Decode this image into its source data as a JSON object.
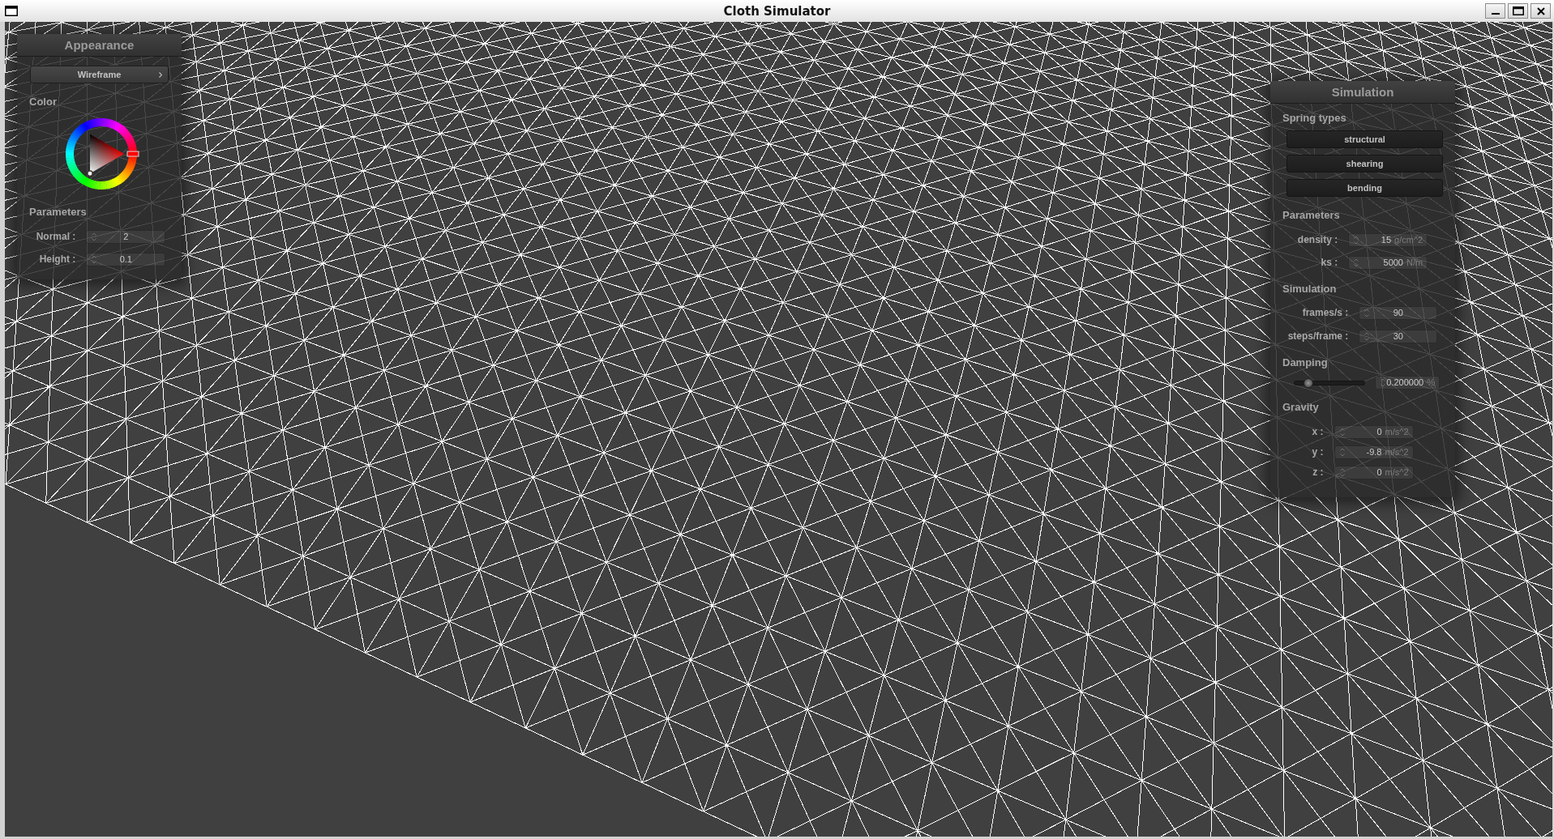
{
  "window": {
    "title": "Cloth Simulator"
  },
  "appearance_panel": {
    "title": "Appearance",
    "mode_button": {
      "label": "Wireframe"
    },
    "color_label": "Color",
    "color_picker": {
      "color": "#ffffff"
    },
    "parameters_label": "Parameters",
    "fields": [
      {
        "label": "Normal :",
        "value": "2"
      },
      {
        "label": "Height :",
        "value": "0.1"
      }
    ]
  },
  "simulation_panel": {
    "title": "Simulation",
    "spring_types": {
      "label": "Spring types",
      "buttons": [
        {
          "label": "structural",
          "on": true
        },
        {
          "label": "shearing",
          "on": true
        },
        {
          "label": "bending",
          "on": true
        }
      ]
    },
    "parameters": {
      "label": "Parameters",
      "fields": [
        {
          "label": "density :",
          "value": "15",
          "unit": "g/cm^2"
        },
        {
          "label": "ks :",
          "value": "5000",
          "unit": "N/m"
        }
      ]
    },
    "simulation": {
      "label": "Simulation",
      "fields": [
        {
          "label": "frames/s :",
          "value": "90"
        },
        {
          "label": "steps/frame :",
          "value": "30"
        }
      ]
    },
    "damping": {
      "label": "Damping",
      "slider": {
        "level": 0.2
      },
      "field": {
        "value": "0.200000",
        "unit": "%"
      }
    },
    "gravity": {
      "label": "Gravity",
      "fields": [
        {
          "label": "x :",
          "value": "0",
          "unit": "m/s^2"
        },
        {
          "label": "y :",
          "value": "-9.8",
          "unit": "m/s^2"
        },
        {
          "label": "z :",
          "value": "0",
          "unit": "m/s^2"
        }
      ]
    }
  }
}
